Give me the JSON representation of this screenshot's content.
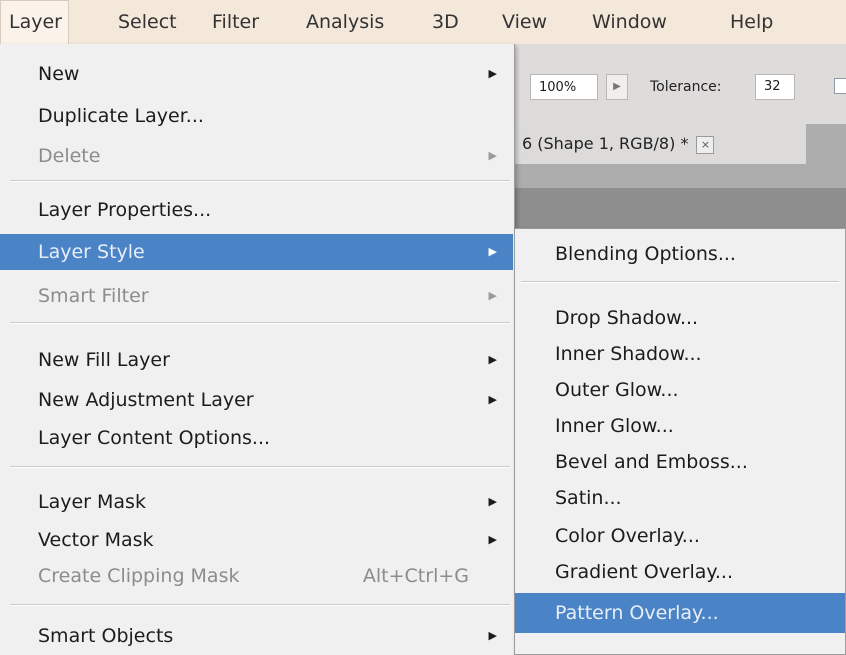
{
  "menubar": {
    "items": [
      "Layer",
      "Select",
      "Filter",
      "Analysis",
      "3D",
      "View",
      "Window",
      "Help"
    ]
  },
  "options_bar": {
    "zoom_value": "100%",
    "tolerance_label": "Tolerance:",
    "tolerance_value": "32"
  },
  "document_tab": {
    "title": "6 (Shape 1, RGB/8) *",
    "close_symbol": "×"
  },
  "layer_menu": {
    "items": [
      {
        "label": "New",
        "submenu": true,
        "disabled": false
      },
      {
        "label": "Duplicate Layer...",
        "submenu": false,
        "disabled": false
      },
      {
        "label": "Delete",
        "submenu": true,
        "disabled": true
      },
      {
        "label": "Layer Properties...",
        "submenu": false,
        "disabled": false
      },
      {
        "label": "Layer Style",
        "submenu": true,
        "disabled": false,
        "highlighted": true
      },
      {
        "label": "Smart Filter",
        "submenu": true,
        "disabled": true
      },
      {
        "label": "New Fill Layer",
        "submenu": true,
        "disabled": false
      },
      {
        "label": "New Adjustment Layer",
        "submenu": true,
        "disabled": false
      },
      {
        "label": "Layer Content Options...",
        "submenu": false,
        "disabled": false
      },
      {
        "label": "Layer Mask",
        "submenu": true,
        "disabled": false
      },
      {
        "label": "Vector Mask",
        "submenu": true,
        "disabled": false
      },
      {
        "label": "Create Clipping Mask",
        "shortcut": "Alt+Ctrl+G",
        "submenu": false,
        "disabled": true
      },
      {
        "label": "Smart Objects",
        "submenu": true,
        "disabled": false
      }
    ]
  },
  "layer_style_submenu": {
    "items": [
      {
        "label": "Blending Options..."
      },
      {
        "label": "Drop Shadow..."
      },
      {
        "label": "Inner Shadow..."
      },
      {
        "label": "Outer Glow..."
      },
      {
        "label": "Inner Glow..."
      },
      {
        "label": "Bevel and Emboss..."
      },
      {
        "label": "Satin..."
      },
      {
        "label": "Color Overlay..."
      },
      {
        "label": "Gradient Overlay..."
      },
      {
        "label": "Pattern Overlay...",
        "highlighted": true
      }
    ]
  },
  "colors": {
    "highlight": "#4b84c6",
    "menu_bg": "#f0f0f0",
    "disabled_text": "#8c8c8c"
  }
}
